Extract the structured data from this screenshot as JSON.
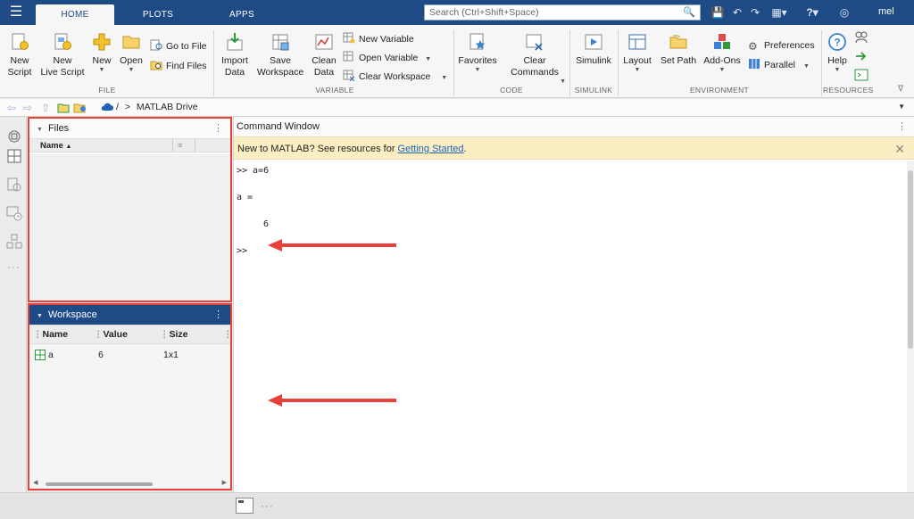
{
  "topbar": {
    "tabs": [
      {
        "label": "HOME",
        "active": true
      },
      {
        "label": "PLOTS",
        "active": false
      },
      {
        "label": "APPS",
        "active": false
      }
    ],
    "search_placeholder": "Search (Ctrl+Shift+Space)",
    "user": "mel"
  },
  "ribbon": {
    "file": {
      "label": "FILE",
      "new_script": "New\nScript",
      "new_live_script": "New\nLive Script",
      "new": "New",
      "open": "Open",
      "go_to_file": "Go to File",
      "find_files": "Find Files"
    },
    "variable": {
      "label": "VARIABLE",
      "import_data": "Import\nData",
      "save_workspace": "Save\nWorkspace",
      "clean_data": "Clean\nData",
      "new_variable": "New Variable",
      "open_variable": "Open Variable",
      "clear_workspace": "Clear Workspace"
    },
    "code": {
      "label": "CODE",
      "favorites": "Favorites",
      "clear_commands": "Clear\nCommands"
    },
    "simulink": {
      "label": "SIMULINK",
      "simulink": "Simulink"
    },
    "environment": {
      "label": "ENVIRONMENT",
      "layout": "Layout",
      "set_path": "Set Path",
      "add_ons": "Add-Ons",
      "preferences": "Preferences",
      "parallel": "Parallel"
    },
    "resources": {
      "label": "RESOURCES",
      "help": "Help"
    }
  },
  "address": {
    "path_sep": "/",
    "path_arrow": ">",
    "path": "MATLAB Drive"
  },
  "files_panel": {
    "title": "Files",
    "col_name": "Name"
  },
  "workspace_panel": {
    "title": "Workspace",
    "columns": [
      "Name",
      "Value",
      "Size"
    ],
    "rows": [
      {
        "name": "a",
        "value": "6",
        "size": "1x1"
      }
    ]
  },
  "command_window": {
    "title": "Command Window",
    "banner_text": "New to MATLAB? See resources for ",
    "banner_link": "Getting Started",
    "banner_end": ".",
    "lines": [
      ">> a=6",
      "a =",
      "6",
      ">>"
    ]
  },
  "colors": {
    "brand_blue": "#1e4a86",
    "highlight_red": "#e8403a",
    "banner_yellow": "#fbeec3"
  }
}
